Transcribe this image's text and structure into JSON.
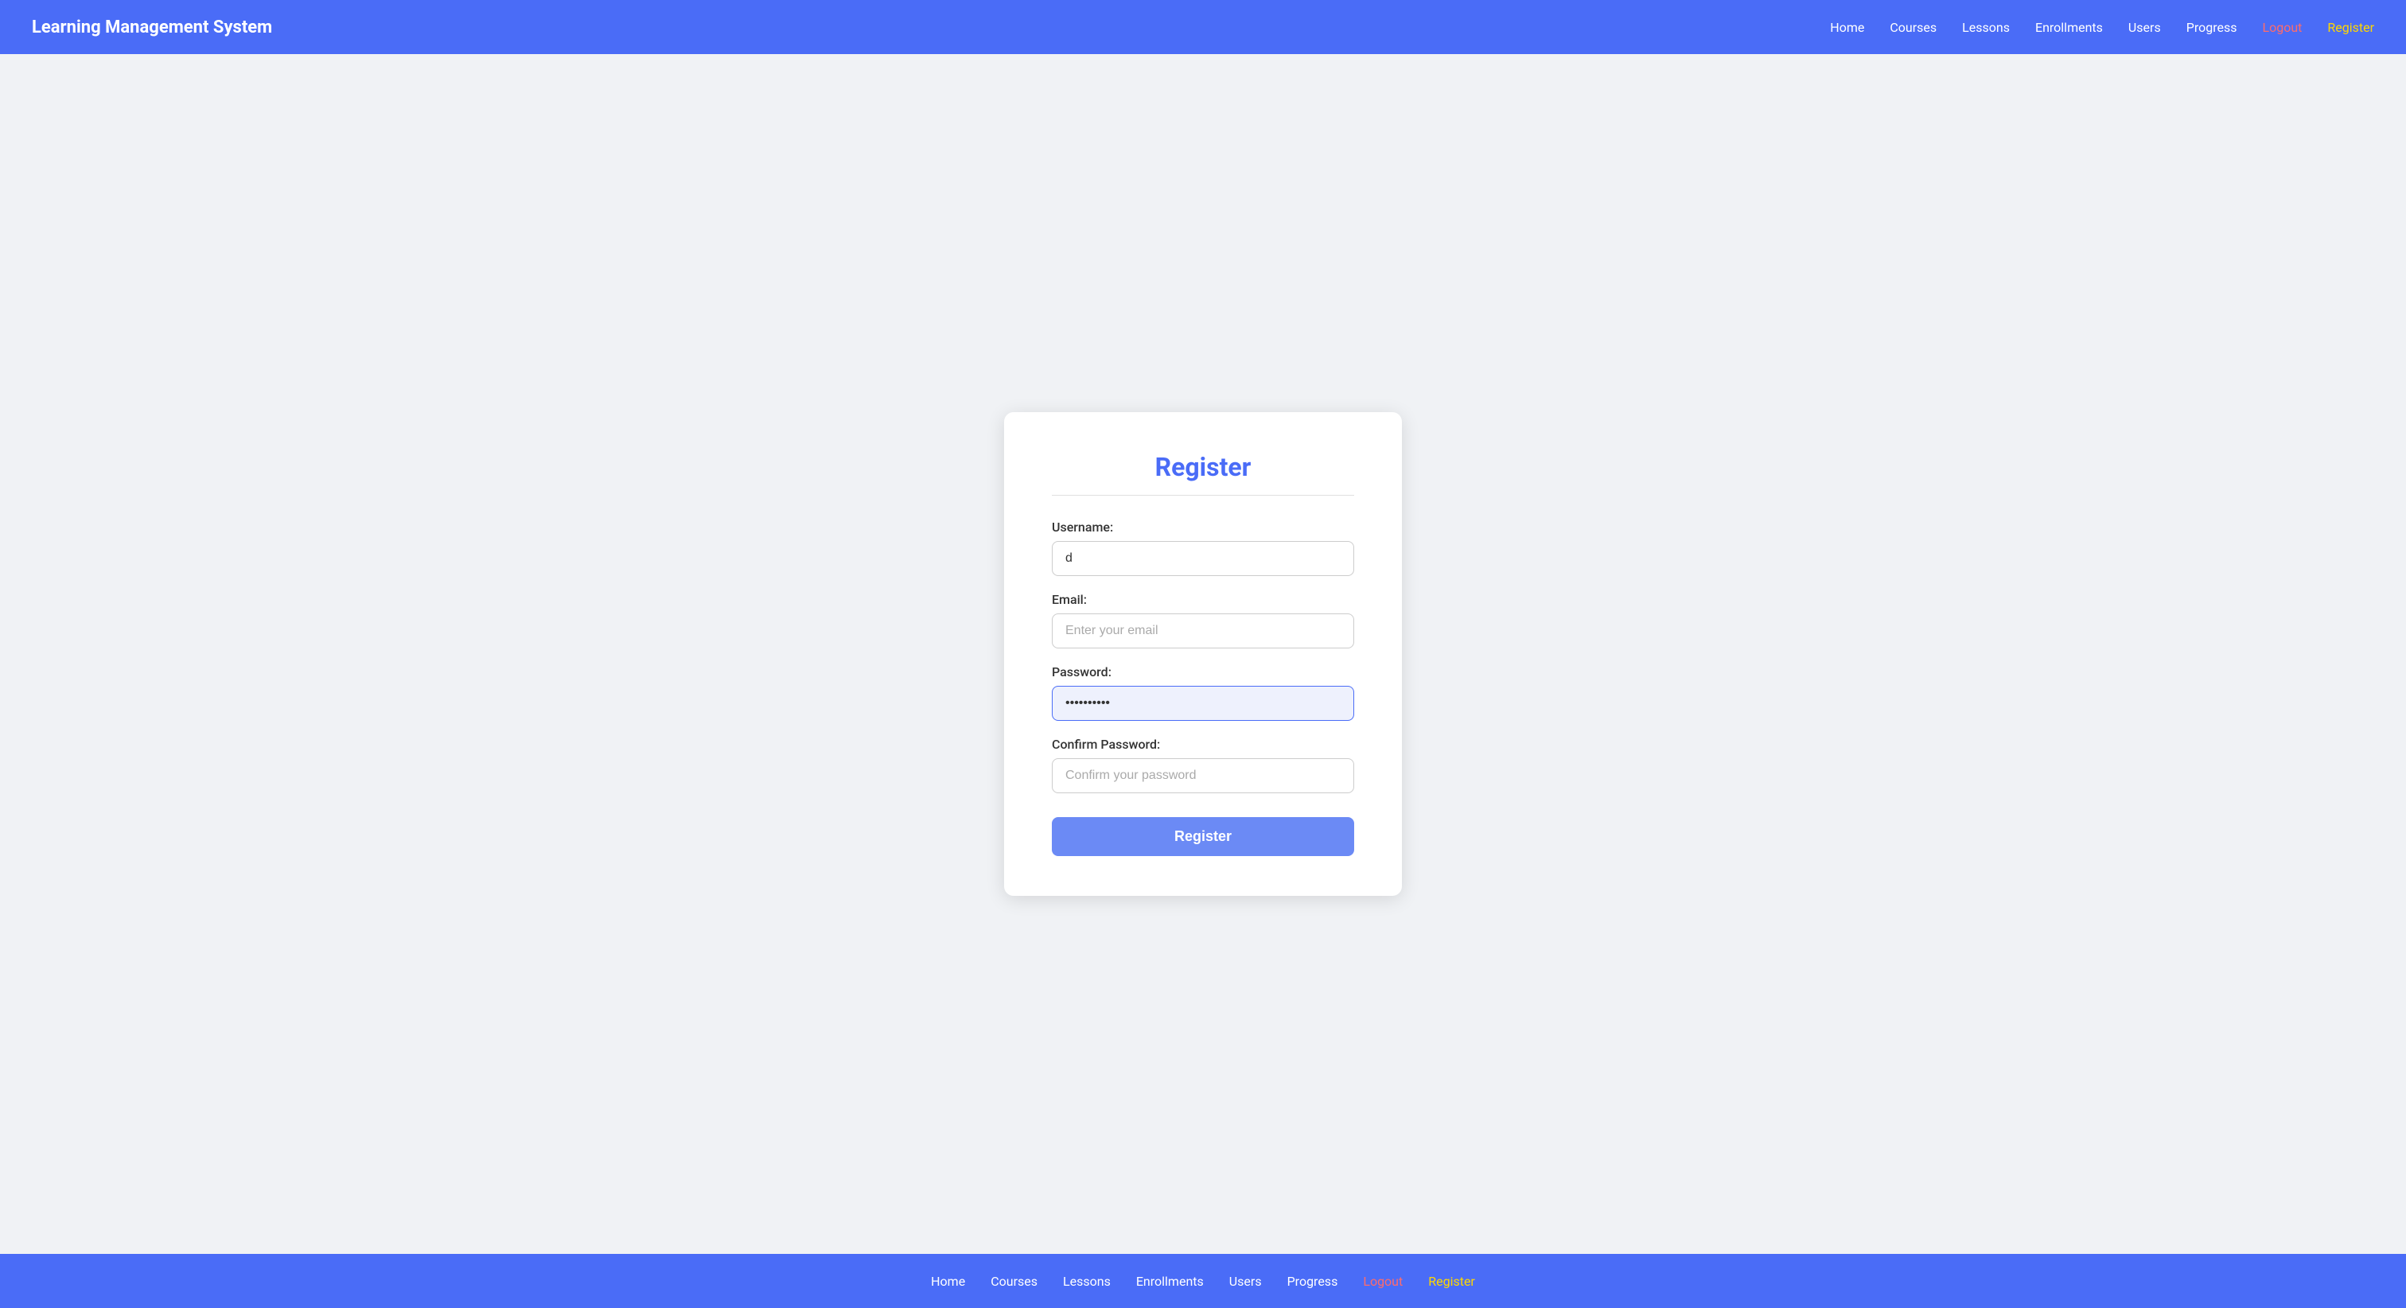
{
  "app": {
    "title": "Learning Management System"
  },
  "navbar": {
    "brand": "Learning Management System",
    "links": [
      {
        "label": "Home",
        "type": "normal"
      },
      {
        "label": "Courses",
        "type": "normal"
      },
      {
        "label": "Lessons",
        "type": "normal"
      },
      {
        "label": "Enrollments",
        "type": "normal"
      },
      {
        "label": "Users",
        "type": "normal"
      },
      {
        "label": "Progress",
        "type": "normal"
      },
      {
        "label": "Logout",
        "type": "logout"
      },
      {
        "label": "Register",
        "type": "register"
      }
    ]
  },
  "form": {
    "title": "Register",
    "fields": {
      "username": {
        "label": "Username:",
        "value": "d",
        "placeholder": ""
      },
      "email": {
        "label": "Email:",
        "value": "",
        "placeholder": "Enter your email"
      },
      "password": {
        "label": "Password:",
        "value": "••••••••••",
        "placeholder": ""
      },
      "confirm_password": {
        "label": "Confirm Password:",
        "value": "",
        "placeholder": "Confirm your password"
      }
    },
    "submit_label": "Register"
  },
  "footer": {
    "links": [
      {
        "label": "Home",
        "type": "normal"
      },
      {
        "label": "Courses",
        "type": "normal"
      },
      {
        "label": "Lessons",
        "type": "normal"
      },
      {
        "label": "Enrollments",
        "type": "normal"
      },
      {
        "label": "Users",
        "type": "normal"
      },
      {
        "label": "Progress",
        "type": "normal"
      },
      {
        "label": "Logout",
        "type": "logout"
      },
      {
        "label": "Register",
        "type": "register"
      }
    ]
  },
  "colors": {
    "primary": "#4a6cf7",
    "logout": "#ff6b6b",
    "register_link": "#ffd700",
    "active_input_bg": "#eef1fd"
  }
}
